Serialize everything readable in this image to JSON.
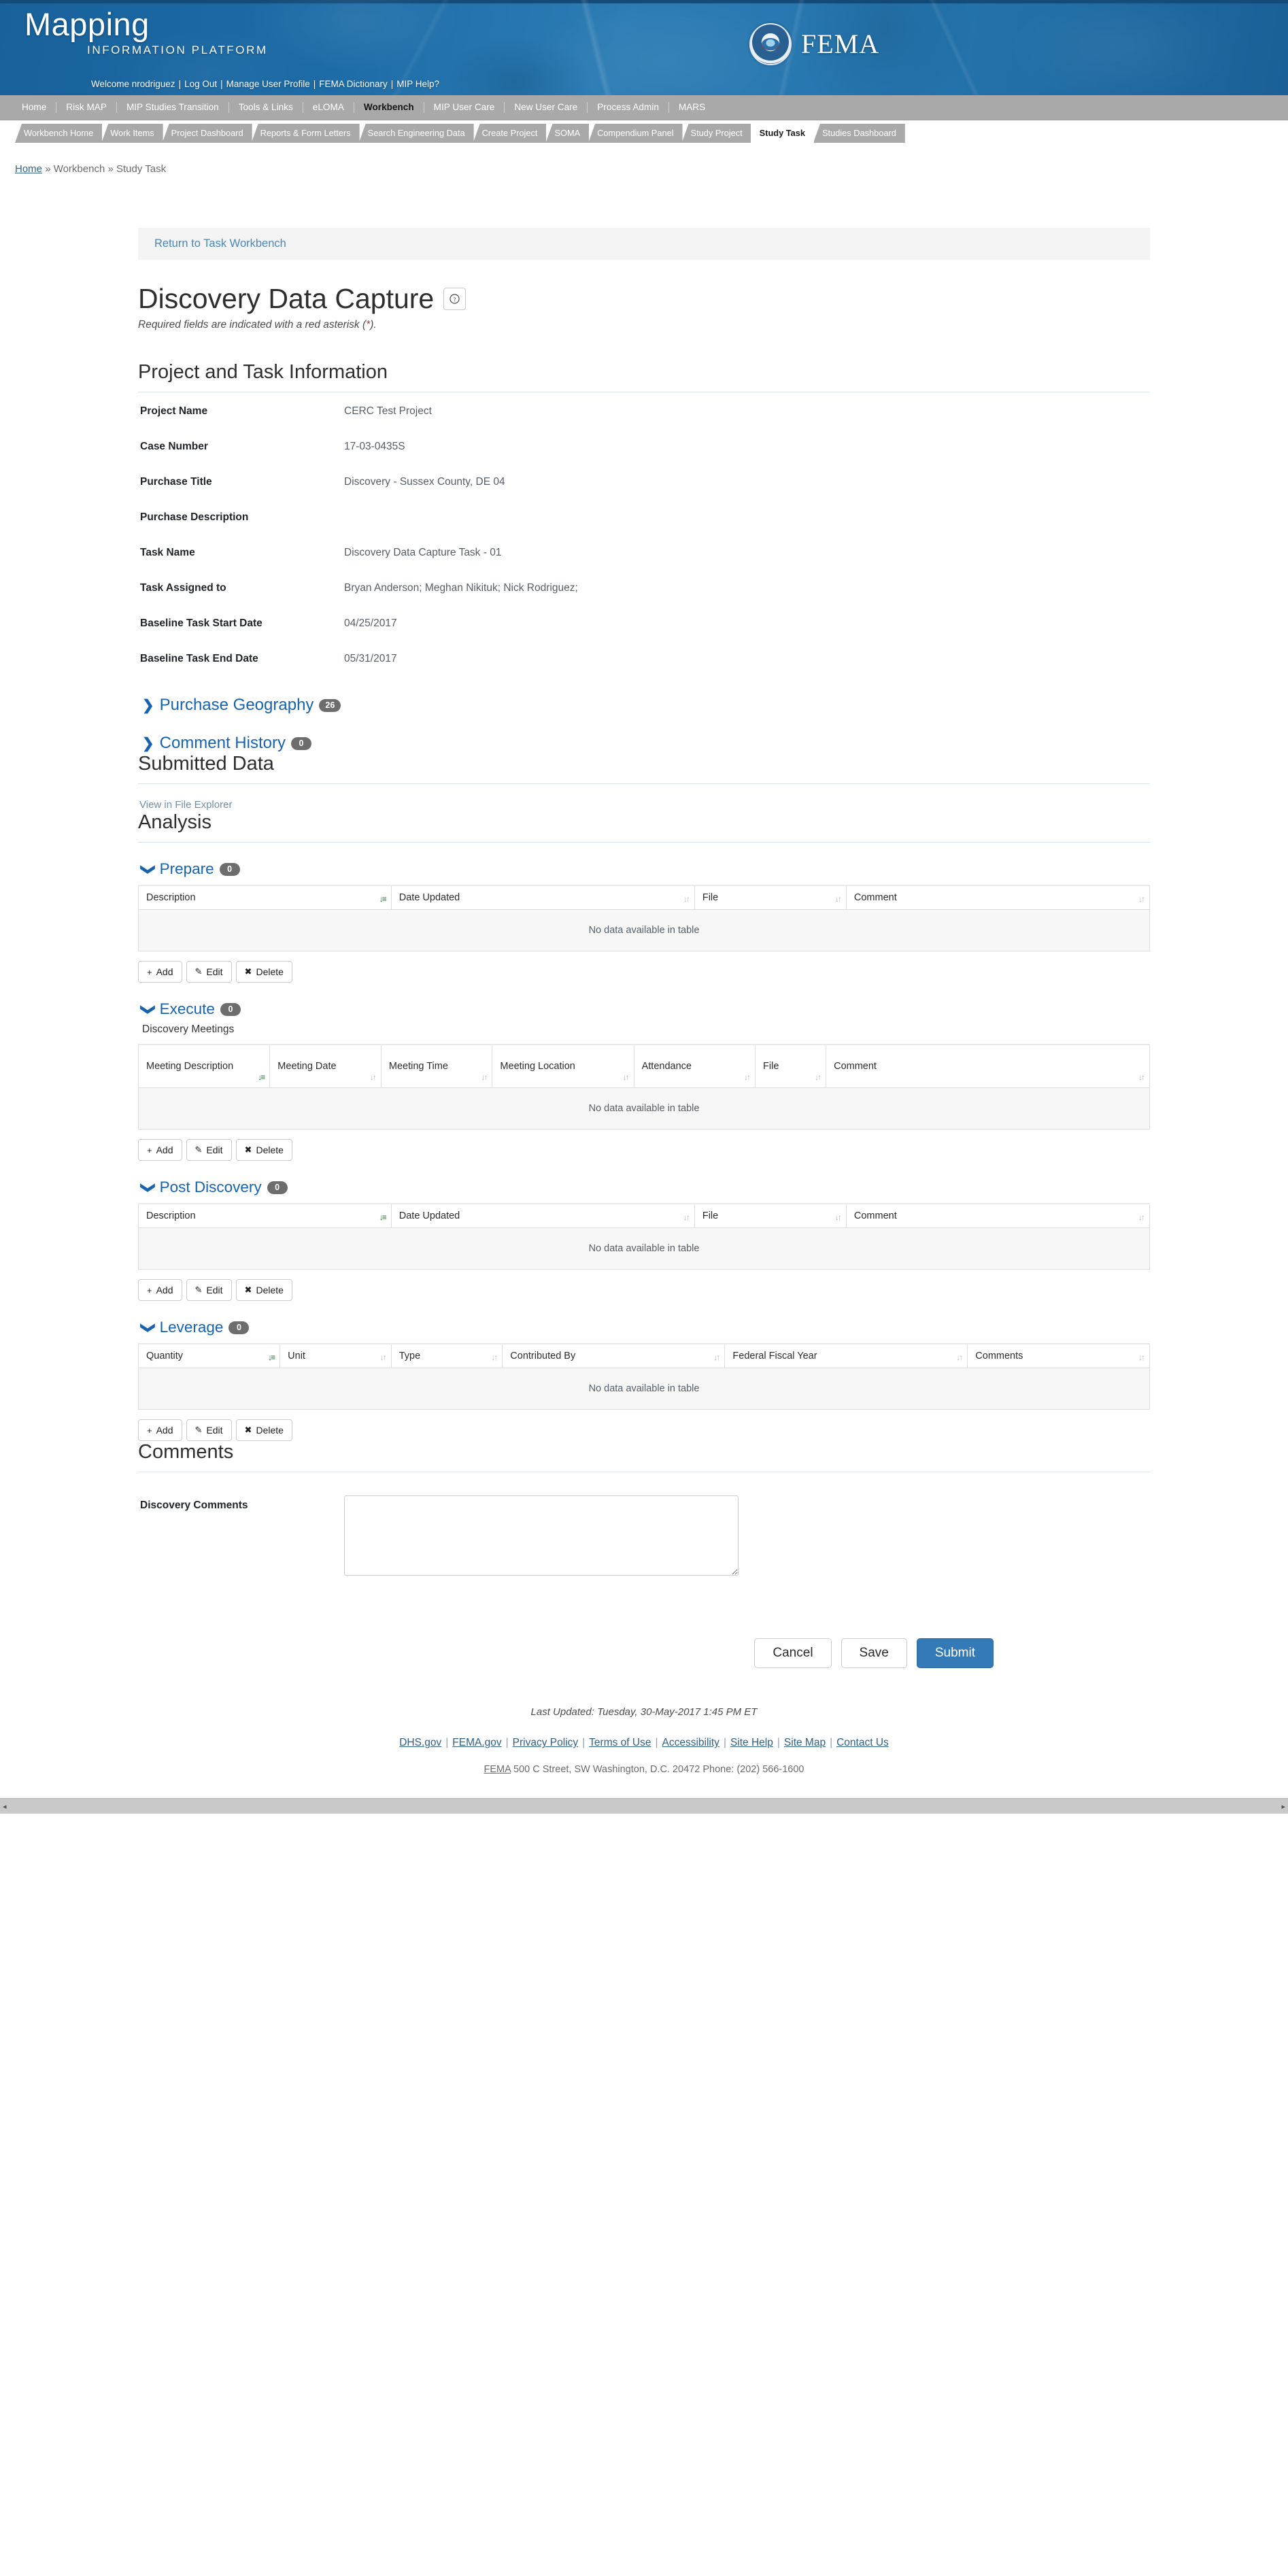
{
  "banner": {
    "brand_line1": "Mapping",
    "brand_line2": "INFORMATION PLATFORM",
    "welcome": "Welcome nrodriguez",
    "utility_links": [
      "Log Out",
      "Manage User Profile",
      "FEMA Dictionary",
      "MIP Help?"
    ],
    "agency": "FEMA",
    "seal_name": "dhs-seal-icon"
  },
  "primary_nav": {
    "items": [
      {
        "label": "Home",
        "active": false
      },
      {
        "label": "Risk MAP",
        "active": false
      },
      {
        "label": "MIP Studies Transition",
        "active": false
      },
      {
        "label": "Tools & Links",
        "active": false
      },
      {
        "label": "eLOMA",
        "active": false
      },
      {
        "label": "Workbench",
        "active": true
      },
      {
        "label": "MIP User Care",
        "active": false
      },
      {
        "label": "New User Care",
        "active": false
      },
      {
        "label": "Process Admin",
        "active": false
      },
      {
        "label": "MARS",
        "active": false
      }
    ]
  },
  "tabs": [
    {
      "label": "Workbench Home",
      "active": false
    },
    {
      "label": "Work Items",
      "active": false
    },
    {
      "label": "Project Dashboard",
      "active": false
    },
    {
      "label": "Reports & Form Letters",
      "active": false
    },
    {
      "label": "Search Engineering Data",
      "active": false
    },
    {
      "label": "Create Project",
      "active": false
    },
    {
      "label": "SOMA",
      "active": false
    },
    {
      "label": "Compendium Panel",
      "active": false
    },
    {
      "label": "Study Project",
      "active": false
    },
    {
      "label": "Study Task",
      "active": true
    },
    {
      "label": "Studies Dashboard",
      "active": false
    }
  ],
  "breadcrumb": {
    "home": "Home",
    "trail": "» Workbench » Study Task"
  },
  "return_bar": {
    "label": "Return to Task Workbench"
  },
  "page": {
    "title": "Discovery Data Capture",
    "help_icon": "help-circle-icon",
    "required_note_pre": "Required fields are indicated with a red asterisk (",
    "required_note_star": "*",
    "required_note_post": ")."
  },
  "project_task": {
    "heading": "Project and Task Information",
    "fields": [
      {
        "label": "Project Name",
        "value": "CERC Test Project"
      },
      {
        "label": "Case Number",
        "value": "17-03-0435S"
      },
      {
        "label": "Purchase Title",
        "value": "Discovery - Sussex County, DE 04"
      },
      {
        "label": "Purchase Description",
        "value": ""
      },
      {
        "label": "Task Name",
        "value": "Discovery Data Capture Task - 01"
      },
      {
        "label": "Task Assigned to",
        "value": "Bryan Anderson; Meghan Nikituk; Nick Rodriguez;"
      },
      {
        "label": "Baseline Task Start Date",
        "value": "04/25/2017"
      },
      {
        "label": "Baseline Task End Date",
        "value": "05/31/2017"
      }
    ]
  },
  "collapsibles": [
    {
      "label": "Purchase Geography",
      "count": "26",
      "state": "collapsed",
      "icon": "chevron-right-icon"
    },
    {
      "label": "Comment History",
      "count": "0",
      "state": "collapsed",
      "icon": "chevron-right-icon"
    }
  ],
  "submitted_data": {
    "heading": "Submitted Data",
    "link": "View in File Explorer"
  },
  "analysis": {
    "heading": "Analysis",
    "empty_text": "No data available in table",
    "buttons": [
      {
        "label": "Add",
        "icon": "plus-icon",
        "glyph": "+"
      },
      {
        "label": "Edit",
        "icon": "pencil-icon",
        "glyph": "✎"
      },
      {
        "label": "Delete",
        "icon": "cross-icon",
        "glyph": "✖"
      }
    ],
    "sections": [
      {
        "label": "Prepare",
        "count": "0",
        "state": "expanded",
        "icon": "chevron-down-icon",
        "subtitle": "",
        "columns": [
          {
            "label": "Description",
            "sorted": true,
            "width": "25%"
          },
          {
            "label": "Date Updated",
            "sorted": false,
            "width": "30%"
          },
          {
            "label": "File",
            "sorted": false,
            "width": "15%"
          },
          {
            "label": "Comment",
            "sorted": false,
            "width": "30%"
          }
        ]
      },
      {
        "label": "Execute",
        "count": "0",
        "state": "expanded",
        "icon": "chevron-down-icon",
        "subtitle": "Discovery Meetings",
        "columns": [
          {
            "label": "Meeting Description",
            "sorted": true,
            "width": "13%"
          },
          {
            "label": "Meeting Date",
            "sorted": false,
            "width": "11%"
          },
          {
            "label": "Meeting Time",
            "sorted": false,
            "width": "11%"
          },
          {
            "label": "Meeting Location",
            "sorted": false,
            "width": "14%"
          },
          {
            "label": "Attendance",
            "sorted": false,
            "width": "12%"
          },
          {
            "label": "File",
            "sorted": false,
            "width": "7%"
          },
          {
            "label": "Comment",
            "sorted": false,
            "width": "32%"
          }
        ]
      },
      {
        "label": "Post Discovery",
        "count": "0",
        "state": "expanded",
        "icon": "chevron-down-icon",
        "subtitle": "",
        "columns": [
          {
            "label": "Description",
            "sorted": true,
            "width": "25%"
          },
          {
            "label": "Date Updated",
            "sorted": false,
            "width": "30%"
          },
          {
            "label": "File",
            "sorted": false,
            "width": "15%"
          },
          {
            "label": "Comment",
            "sorted": false,
            "width": "30%"
          }
        ]
      },
      {
        "label": "Leverage",
        "count": "0",
        "state": "expanded",
        "icon": "chevron-down-icon",
        "subtitle": "",
        "columns": [
          {
            "label": "Quantity",
            "sorted": true,
            "width": "14%"
          },
          {
            "label": "Unit",
            "sorted": false,
            "width": "11%"
          },
          {
            "label": "Type",
            "sorted": false,
            "width": "11%"
          },
          {
            "label": "Contributed By",
            "sorted": false,
            "width": "22%"
          },
          {
            "label": "Federal Fiscal Year",
            "sorted": false,
            "width": "24%"
          },
          {
            "label": "Comments",
            "sorted": false,
            "width": "18%"
          }
        ]
      }
    ]
  },
  "comments": {
    "heading": "Comments",
    "field_label": "Discovery Comments",
    "value": "",
    "placeholder": ""
  },
  "actions": {
    "cancel": "Cancel",
    "save": "Save",
    "submit": "Submit"
  },
  "footer": {
    "last_updated": "Last Updated: Tuesday, 30-May-2017 1:45 PM ET",
    "links": [
      "DHS.gov",
      "FEMA.gov",
      "Privacy Policy",
      "Terms of Use",
      "Accessibility",
      "Site Help",
      "Site Map",
      "Contact Us"
    ],
    "address_prefix": "FEMA",
    "address": " 500 C Street, SW Washington, D.C. 20472 Phone: (202) 566-1600"
  },
  "colors": {
    "banner_blue": "#2c7cb4",
    "nav_gray": "#a9a9a9",
    "link_blue": "#1763b0",
    "primary_button": "#337ab7",
    "badge_gray": "#6d6d6d",
    "sort_active_green": "#2f6b3a"
  }
}
